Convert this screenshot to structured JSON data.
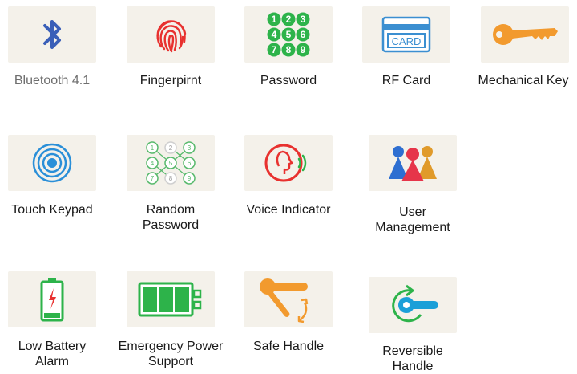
{
  "features": [
    {
      "id": "bluetooth",
      "label": "Bluetooth 4.1",
      "icon": "bluetooth-icon",
      "color": "#3a5fb8"
    },
    {
      "id": "fingerprint",
      "label": "Fingerpirnt",
      "icon": "fingerprint-icon",
      "color": "#e8312f"
    },
    {
      "id": "password",
      "label": "Password",
      "icon": "number-pad-icon",
      "digits": [
        "1",
        "2",
        "3",
        "4",
        "5",
        "6",
        "7",
        "8",
        "9"
      ],
      "color": "#2db34a"
    },
    {
      "id": "rf-card",
      "label": "RF Card",
      "icon": "rf-card-icon",
      "card_text": "CARD",
      "color": "#3b8fd1"
    },
    {
      "id": "mechanical-key",
      "label": "Mechanical Key",
      "icon": "key-icon",
      "color": "#f29a2e"
    },
    {
      "id": "touch-keypad",
      "label": "Touch Keypad",
      "icon": "touch-rings-icon",
      "color": "#2a8fd8"
    },
    {
      "id": "random-password",
      "label": "Random\nPassword",
      "icon": "random-keypad-icon",
      "digits": [
        "1",
        "2",
        "3",
        "4",
        "5",
        "6",
        "7",
        "8",
        "9"
      ],
      "color": "#56b96b"
    },
    {
      "id": "voice-indicator",
      "label": "Voice Indicator",
      "icon": "voice-icon",
      "color": "#e8312f"
    },
    {
      "id": "user-management",
      "label": "User\nManagement",
      "icon": "users-icon",
      "colors": [
        "#2e6fd1",
        "#e6354a",
        "#e09a2a"
      ]
    },
    {
      "id": "low-battery",
      "label": "Low Battery\nAlarm",
      "icon": "low-battery-icon",
      "color": "#2db34a"
    },
    {
      "id": "emergency-power",
      "label": "Emergency Power\nSupport",
      "icon": "battery-full-icon",
      "color": "#2db34a"
    },
    {
      "id": "safe-handle",
      "label": "Safe Handle",
      "icon": "safe-handle-icon",
      "color": "#f29a2e"
    },
    {
      "id": "reversible-handle",
      "label": "Reversible\nHandle",
      "icon": "reversible-handle-icon",
      "color": "#1a9fd8"
    }
  ]
}
